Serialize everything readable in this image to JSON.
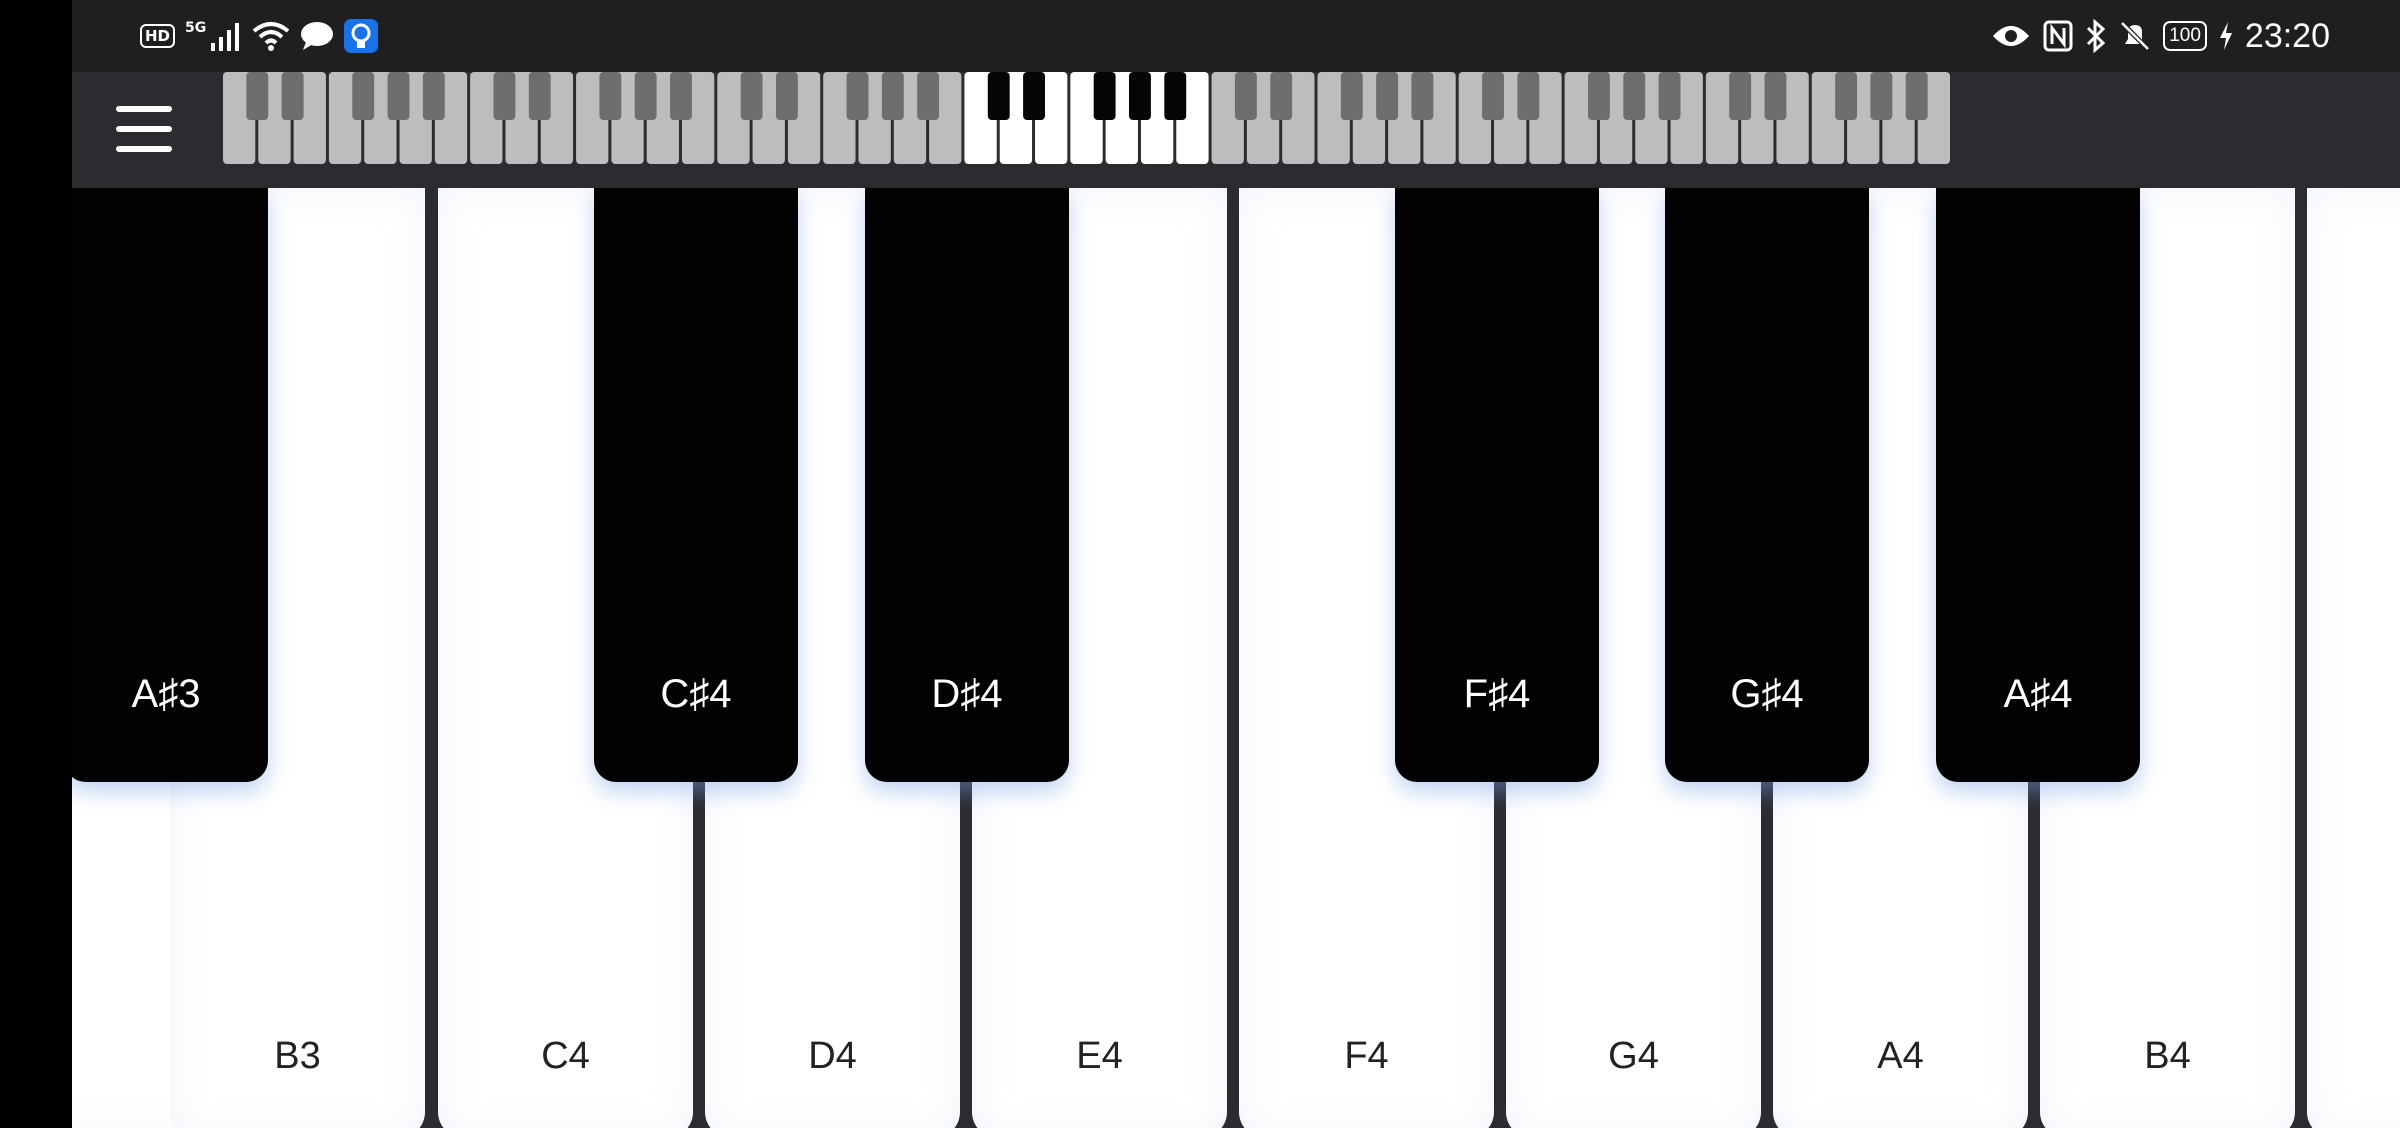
{
  "status_bar": {
    "left_badge": "HD",
    "network": "5G",
    "battery": "100",
    "time": "23:20",
    "icons_left": [
      "hd-icon",
      "signal-icon",
      "wifi-icon",
      "message-icon",
      "bulb-app-icon"
    ],
    "icons_right": [
      "eye-icon",
      "nfc-icon",
      "bluetooth-icon",
      "mute-icon",
      "battery-icon",
      "charging-icon"
    ]
  },
  "toolbar": {
    "menu_icon": "hamburger-menu-icon",
    "overview_visible_range": {
      "first_white_index": 21,
      "count": 7,
      "total_white": 49
    }
  },
  "keyboard": {
    "white_keys": [
      "",
      "B3",
      "C4",
      "D4",
      "E4",
      "F4",
      "G4",
      "A4",
      "B4",
      ""
    ],
    "black_keys": [
      {
        "label": "A♯3"
      },
      {
        "label": "C♯4"
      },
      {
        "label": "D♯4"
      },
      {
        "label": "F♯4"
      },
      {
        "label": "G♯4"
      },
      {
        "label": "A♯4"
      }
    ]
  },
  "colors": {
    "status_bg": "#1f1f21",
    "toolbar_bg": "#2b2c30",
    "white_key": "#ffffff",
    "black_key": "#020202",
    "inactive_overview": "#bdbdbf",
    "accent_glow": "#78a0e6"
  }
}
